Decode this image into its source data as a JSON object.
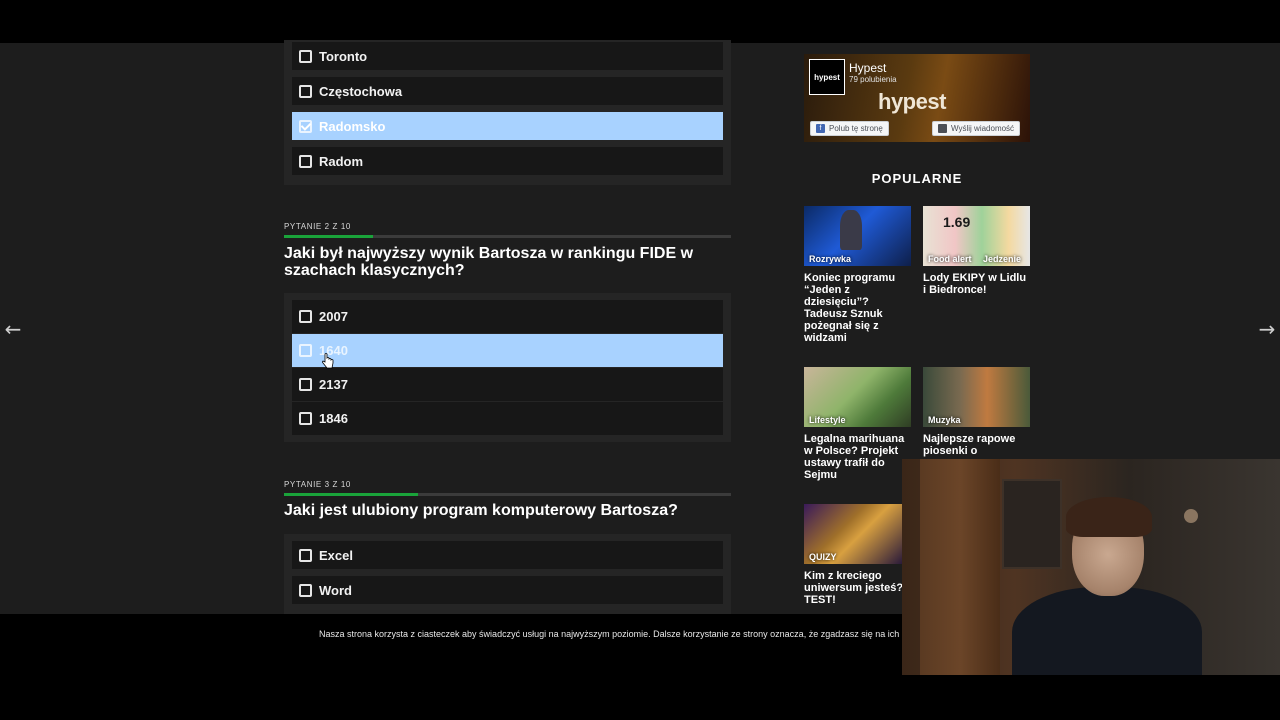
{
  "quiz": {
    "q1": {
      "answers": [
        {
          "label": "Toronto",
          "checked": false
        },
        {
          "label": "Częstochowa",
          "checked": false
        },
        {
          "label": "Radomsko",
          "checked": true
        },
        {
          "label": "Radom",
          "checked": false
        }
      ]
    },
    "q2": {
      "counter": "PYTANIE 2 Z 10",
      "progress": 0.2,
      "question": "Jaki był najwyższy wynik Bartosza w rankingu FIDE w szachach klasycznych?",
      "answers": [
        {
          "label": "2007"
        },
        {
          "label": "1640"
        },
        {
          "label": "2137"
        },
        {
          "label": "1846"
        }
      ]
    },
    "q3": {
      "counter": "PYTANIE 3 Z 10",
      "progress": 0.3,
      "question": "Jaki jest ulubiony program komputerowy Bartosza?",
      "answers": [
        {
          "label": "Excel"
        },
        {
          "label": "Word"
        }
      ]
    }
  },
  "sidebar": {
    "facebook": {
      "page_name": "Hypest",
      "likes": "79 polubienia",
      "logo_text": "hypest",
      "brand_text": "hypest",
      "like_button": "Polub tę stronę",
      "message_button": "Wyślij wiadomość"
    },
    "popular_title": "POPULARNE",
    "cards": [
      {
        "tag": "Rozrywka",
        "title": "Koniec programu “Jeden z dziesięciu”? Tadeusz Sznuk pożegnał się z widzami"
      },
      {
        "tag": "Food alert",
        "tag2": "Jedzenie",
        "title": "Lody EKIPY w Lidlu i Biedronce!"
      },
      {
        "tag": "Lifestyle",
        "title": "Legalna marihuana w Polsce? Projekt ustawy trafił do Sejmu"
      },
      {
        "tag": "Muzyka",
        "title": "Najlepsze rapowe piosenki o"
      },
      {
        "tag": "QUIZY",
        "title": "Kim z kreciego uniwersum jesteś? TEST!"
      }
    ]
  },
  "cookie_notice": "Nasza strona korzysta z ciasteczek aby świadczyć usługi na najwyższym poziomie. Dalsze korzystanie ze strony oznacza, że zgadzasz się na ich uży",
  "nav": {
    "prev_icon": "arrow-left-icon",
    "next_icon": "arrow-right-icon"
  },
  "colors": {
    "selected": "#a8d2ff",
    "progress": "#1aa33a",
    "background": "#1d1d1d"
  }
}
